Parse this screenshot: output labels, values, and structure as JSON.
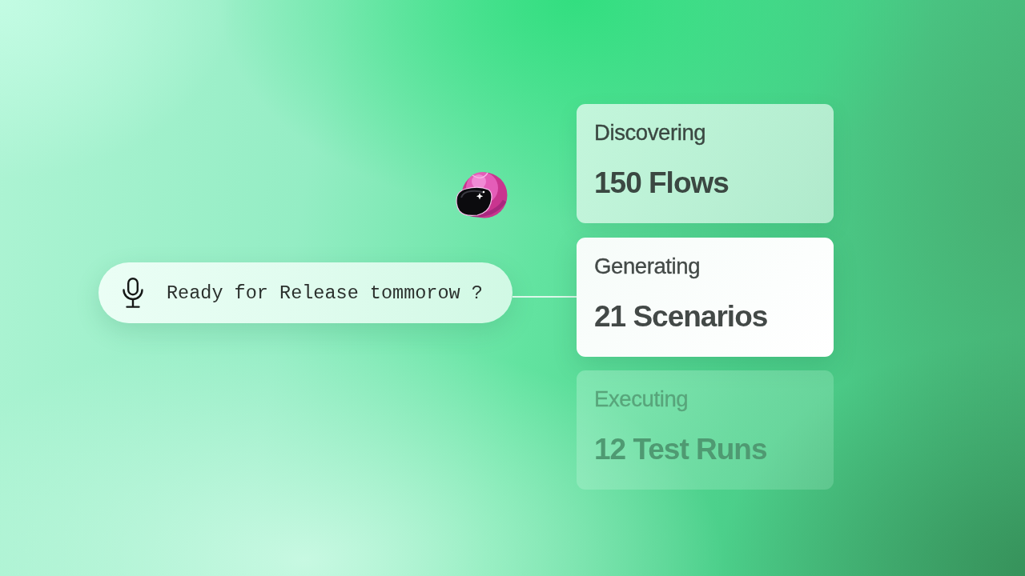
{
  "prompt": {
    "text": "Ready for Release tommorow ?"
  },
  "steps": [
    {
      "label": "Discovering",
      "count": "150 Flows",
      "completed": true,
      "selected": false
    },
    {
      "label": "Generating",
      "count": "21 Scenarios",
      "completed": false,
      "selected": true
    },
    {
      "label": "Executing",
      "count": "12 Test Runs",
      "completed": false,
      "selected": false
    }
  ]
}
